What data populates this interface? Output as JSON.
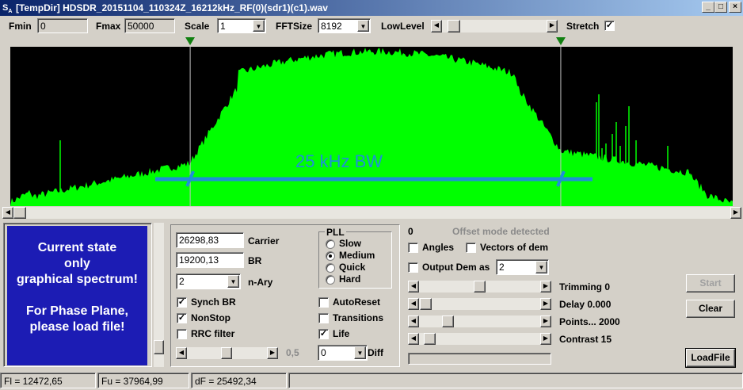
{
  "window": {
    "title": "[TempDir] HDSDR_20151104_110324Z_16212kHz_RF(0)(sdr1)(c1).wav",
    "icon": "sa-app-icon",
    "controls": [
      "_",
      "□",
      "×"
    ]
  },
  "toolbar": {
    "fmin_label": "Fmin",
    "fmin_value": "0",
    "fmax_label": "Fmax",
    "fmax_value": "50000",
    "scale_label": "Scale",
    "scale_value": "1",
    "fftsize_label": "FFTSize",
    "fftsize_value": "8192",
    "lowlevel_label": "LowLevel",
    "lowlevel_position": 0.06,
    "stretch_label": "Stretch",
    "stretch_checked": true
  },
  "spectrum": {
    "annotation": "25 kHz BW",
    "marker_left_fraction": 0.249,
    "marker_right_fraction": 0.762,
    "color": "#00ff00",
    "annotation_color": "#1e90d6",
    "hscroll_position": 0.0
  },
  "info_panel": {
    "line1": "Current state",
    "line2": "only",
    "line3": "graphical spectrum!",
    "line4": "For Phase Plane,",
    "line5": "please load file!",
    "bg_color": "#1c1cb4"
  },
  "demod": {
    "carrier_value": "26298,83",
    "carrier_label": "Carrier",
    "br_value": "19200,13",
    "br_label": "BR",
    "nary_value": "2",
    "nary_label": "n-Ary",
    "pll_title": "PLL",
    "pll_options": [
      "Slow",
      "Medium",
      "Quick",
      "Hard"
    ],
    "pll_selected": "Medium",
    "synch_br_label": "Synch BR",
    "synch_br_checked": true,
    "nonstop_label": "NonStop",
    "nonstop_checked": true,
    "rrc_label": "RRC filter",
    "rrc_checked": false,
    "autoreset_label": "AutoReset",
    "autoreset_checked": false,
    "transitions_label": "Transitions",
    "transitions_checked": false,
    "life_label": "Life",
    "life_checked": true,
    "slider_value": "0,5",
    "diff_value": "0",
    "diff_label": "Diff"
  },
  "display": {
    "counter": "0",
    "offset_status": "Offset mode detected",
    "angles_label": "Angles",
    "angles_checked": false,
    "vectors_label": "Vectors of dem",
    "vectors_checked": false,
    "output_dem_label": "Output Dem as",
    "output_dem_checked": false,
    "output_dem_value": "2",
    "trimming_label": "Trimming 0",
    "delay_label": "Delay  0.000",
    "points_label": "Points... 2000",
    "contrast_label": "Contrast 15"
  },
  "buttons": {
    "start": "Start",
    "clear": "Clear",
    "loadfile": "LoadFile"
  },
  "statusbar": {
    "fl": "Fl = 12472,65",
    "fu": "Fu = 37964,99",
    "df": "dF = 25492,34",
    "extra": ""
  }
}
